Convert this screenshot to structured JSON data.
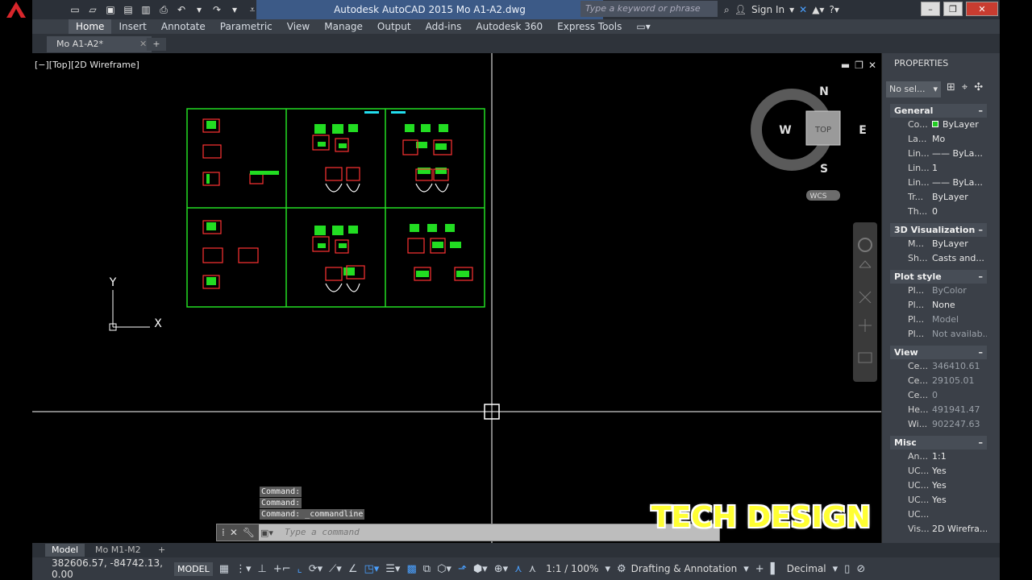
{
  "title_bar": {
    "app_title": "Autodesk AutoCAD 2015   Mo A1-A2.dwg",
    "search_placeholder": "Type a keyword or phrase",
    "sign_in": "Sign In"
  },
  "ribbon_tabs": [
    "Home",
    "Insert",
    "Annotate",
    "Parametric",
    "View",
    "Manage",
    "Output",
    "Add-ins",
    "Autodesk 360",
    "Express Tools"
  ],
  "file_tab": {
    "name": "Mo A1-A2*",
    "add": "+"
  },
  "viewport": {
    "label": "[−][Top][2D Wireframe]",
    "viewcube": {
      "n": "N",
      "s": "S",
      "e": "E",
      "w": "W",
      "face": "TOP",
      "wcs": "WCS"
    },
    "ucs": {
      "x": "X",
      "y": "Y"
    }
  },
  "command": {
    "history": [
      "Command:",
      "Command:",
      "Command: _commandline"
    ],
    "placeholder": "Type a command"
  },
  "watermark": "TECH DESIGN",
  "properties": {
    "title": "PROPERTIES",
    "selection": "No sel...",
    "sections": [
      {
        "title": "General",
        "rows": [
          {
            "name": "Co...",
            "value": "ByLayer",
            "swatch": "#22cc22"
          },
          {
            "name": "La...",
            "value": "Mo"
          },
          {
            "name": "Lin...",
            "value": "—— ByLa..."
          },
          {
            "name": "Lin...",
            "value": "1"
          },
          {
            "name": "Lin...",
            "value": "—— ByLa..."
          },
          {
            "name": "Tr...",
            "value": "ByLayer"
          },
          {
            "name": "Th...",
            "value": "0"
          }
        ]
      },
      {
        "title": "3D Visualization",
        "rows": [
          {
            "name": "M...",
            "value": "ByLayer"
          },
          {
            "name": "Sh...",
            "value": "Casts and..."
          }
        ]
      },
      {
        "title": "Plot style",
        "rows": [
          {
            "name": "Pl...",
            "value": "ByColor",
            "dim": true
          },
          {
            "name": "Pl...",
            "value": "None"
          },
          {
            "name": "Pl...",
            "value": "Model",
            "dim": true
          },
          {
            "name": "Pl...",
            "value": "Not availab...",
            "dim": true
          }
        ]
      },
      {
        "title": "View",
        "rows": [
          {
            "name": "Ce...",
            "value": "346410.61",
            "dim": true
          },
          {
            "name": "Ce...",
            "value": "29105.01",
            "dim": true
          },
          {
            "name": "Ce...",
            "value": "0",
            "dim": true
          },
          {
            "name": "He...",
            "value": "491941.47",
            "dim": true
          },
          {
            "name": "Wi...",
            "value": "902247.63",
            "dim": true
          }
        ]
      },
      {
        "title": "Misc",
        "rows": [
          {
            "name": "An...",
            "value": "1:1"
          },
          {
            "name": "UC...",
            "value": "Yes"
          },
          {
            "name": "UC...",
            "value": "Yes"
          },
          {
            "name": "UC...",
            "value": "Yes"
          },
          {
            "name": "UC...",
            "value": ""
          },
          {
            "name": "Vis...",
            "value": "2D Wirefra..."
          }
        ]
      }
    ]
  },
  "layout_tabs": [
    "Model",
    "Mo M1-M2"
  ],
  "status": {
    "coords": "382606.57, -84742.13, 0.00",
    "model": "MODEL",
    "scale": "1:1 / 100%",
    "workspace": "Drafting & Annotation",
    "units": "Decimal"
  },
  "colors": {
    "grid_green": "#22dd22",
    "accent_blue": "#3c5a87",
    "cyan": "#22ddee"
  }
}
